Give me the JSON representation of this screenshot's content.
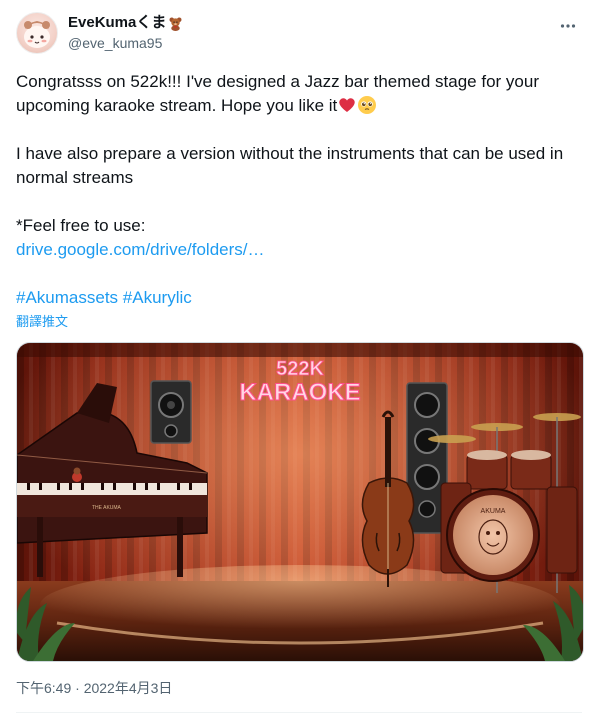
{
  "author": {
    "display_name": "EveKumaくま",
    "name_emoji": "teddy-bear-icon",
    "handle": "@eve_kuma95"
  },
  "more_icon": "more-dots-icon",
  "tweet": {
    "line1": "Congratsss on 522k!!! I've designed a Jazz bar themed stage for your upcoming karaoke stream. Hope you like it",
    "line1_emojis": [
      "red-heart-icon",
      "pleading-face-icon"
    ],
    "para2": "I have also prepare a version without the instruments that can be used in normal streams",
    "para3": "*Feel free to use:",
    "link": "drive.google.com/drive/folders/…",
    "hashtag1": "#Akumassets",
    "hashtag2": "#Akurylic"
  },
  "translate_label": "翻譯推文",
  "media": {
    "sign_line1": "522K",
    "sign_line2": "KARAOKE",
    "drum_text": "AKUMA",
    "piano_text": "THE AKUMA"
  },
  "timestamp": "下午6:49 · 2022年4月3日",
  "colors": {
    "link": "#1d9bf0",
    "secondary_text": "#536471",
    "curtain": "#a8301c",
    "neon": "#ff6fa0"
  }
}
